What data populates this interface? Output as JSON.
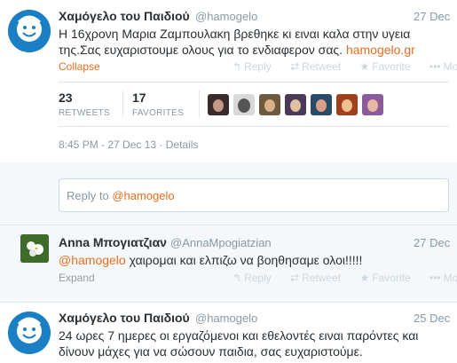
{
  "tweet1": {
    "name": "Χαμόγελο του Παιδιού",
    "handle": "@hamogelo",
    "date": "27 Dec",
    "text": "Η 16χρονη Μαρια Ζαμπουλακη βρεθηκε κι ειναι καλα στην υγεια της.Σας ευχαριστουμε ολους για το ενδιαφερον σας.",
    "link": "hamogelo.gr",
    "collapse": "Collapse",
    "actions": {
      "reply": "Reply",
      "retweet": "Retweet",
      "favorite": "Favorite",
      "more": "More"
    },
    "retweets_count": "23",
    "retweets_label": "RETWEETS",
    "favorites_count": "17",
    "favorites_label": "FAVORITES",
    "timestamp": "8:45 PM - 27 Dec 13",
    "details": "Details"
  },
  "reply": {
    "prefix": "Reply to ",
    "mention": "@hamogelo"
  },
  "tweet2": {
    "name": "Anna Μπογιατζιαν",
    "handle": "@AnnaMpogiatzian",
    "date": "27 Dec",
    "mention": "@hamogelo",
    "text": " χαιρομαι και ελπιζω να βοηθησαμε ολοι!!!!!",
    "expand": "Expand",
    "actions": {
      "reply": "Reply",
      "retweet": "Retweet",
      "favorite": "Favorite",
      "more": "More"
    }
  },
  "tweet3": {
    "name": "Χαμόγελο του Παιδιού",
    "handle": "@hamogelo",
    "date": "25 Dec",
    "text": "24 ωρες 7 ημερες οι εργαζόμενοι και εθελοντές ειναι παρόντες και δίνουν μάχες για να σώσουν παιδια, σας ευχαριστούμε."
  },
  "colors": {
    "accent": "#e76e1f",
    "logo_blue": "#1a7fc4"
  }
}
